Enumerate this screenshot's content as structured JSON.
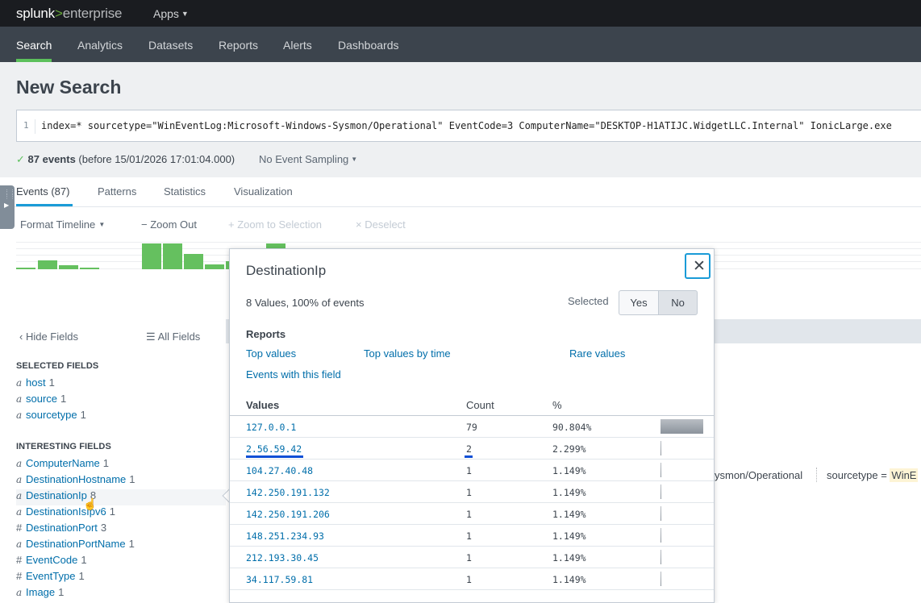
{
  "header": {
    "logo_splunk": "splunk",
    "logo_gt": ">",
    "logo_enterprise": "enterprise",
    "apps_label": "Apps"
  },
  "nav": {
    "items": [
      "Search",
      "Analytics",
      "Datasets",
      "Reports",
      "Alerts",
      "Dashboards"
    ]
  },
  "search": {
    "title": "New Search",
    "line_no": "1",
    "query": "index=* sourcetype=\"WinEventLog:Microsoft-Windows-Sysmon/Operational\" EventCode=3 ComputerName=\"DESKTOP-H1ATIJC.WidgetLLC.Internal\" IonicLarge.exe",
    "events_count": "87 events",
    "events_before": "(before 15/01/2026 17:01:04.000)",
    "sampling": "No Event Sampling"
  },
  "result_tabs": [
    "Events (87)",
    "Patterns",
    "Statistics",
    "Visualization"
  ],
  "timeline": {
    "format": "Format Timeline",
    "zoom_out": "Zoom Out",
    "zoom_selection": "Zoom to Selection",
    "deselect": "Deselect",
    "bars": [
      0.05,
      0.35,
      0.15,
      0.05,
      0,
      0,
      1.0,
      1.0,
      0.6,
      0.2,
      0.3,
      0,
      0,
      1.0
    ]
  },
  "fields": {
    "hide": "Hide Fields",
    "all": "All Fields",
    "selected_header": "SELECTED FIELDS",
    "selected": [
      {
        "type": "a",
        "name": "host",
        "count": "1"
      },
      {
        "type": "a",
        "name": "source",
        "count": "1"
      },
      {
        "type": "a",
        "name": "sourcetype",
        "count": "1"
      }
    ],
    "interesting_header": "INTERESTING FIELDS",
    "interesting": [
      {
        "type": "a",
        "name": "ComputerName",
        "count": "1"
      },
      {
        "type": "a",
        "name": "DestinationHostname",
        "count": "1"
      },
      {
        "type": "a",
        "name": "DestinationIp",
        "count": "8"
      },
      {
        "type": "a",
        "name": "DestinationIsIpv6",
        "count": "1"
      },
      {
        "type": "#",
        "name": "DestinationPort",
        "count": "3"
      },
      {
        "type": "a",
        "name": "DestinationPortName",
        "count": "1"
      },
      {
        "type": "#",
        "name": "EventCode",
        "count": "1"
      },
      {
        "type": "#",
        "name": "EventType",
        "count": "1"
      },
      {
        "type": "a",
        "name": "Image",
        "count": "1"
      }
    ]
  },
  "event_snippet": {
    "source_tail": "ysmon/Operational",
    "sourcetype_label": "sourcetype =",
    "sourcetype_val": "WinE"
  },
  "popup": {
    "title": "DestinationIp",
    "summary": "8 Values, 100% of events",
    "selected_label": "Selected",
    "yes": "Yes",
    "no": "No",
    "reports_label": "Reports",
    "links": [
      "Top values",
      "Top values by time",
      "Rare values",
      "Events with this field"
    ],
    "columns": [
      "Values",
      "Count",
      "%"
    ],
    "rows": [
      {
        "value": "127.0.0.1",
        "count": "79",
        "pct": "90.804%",
        "frac": 0.90804
      },
      {
        "value": "2.56.59.42",
        "count": "2",
        "pct": "2.299%",
        "frac": 0.02299
      },
      {
        "value": "104.27.40.48",
        "count": "1",
        "pct": "1.149%",
        "frac": 0.01149
      },
      {
        "value": "142.250.191.132",
        "count": "1",
        "pct": "1.149%",
        "frac": 0.01149
      },
      {
        "value": "142.250.191.206",
        "count": "1",
        "pct": "1.149%",
        "frac": 0.01149
      },
      {
        "value": "148.251.234.93",
        "count": "1",
        "pct": "1.149%",
        "frac": 0.01149
      },
      {
        "value": "212.193.30.45",
        "count": "1",
        "pct": "1.149%",
        "frac": 0.01149
      },
      {
        "value": "34.117.59.81",
        "count": "1",
        "pct": "1.149%",
        "frac": 0.01149
      }
    ]
  }
}
